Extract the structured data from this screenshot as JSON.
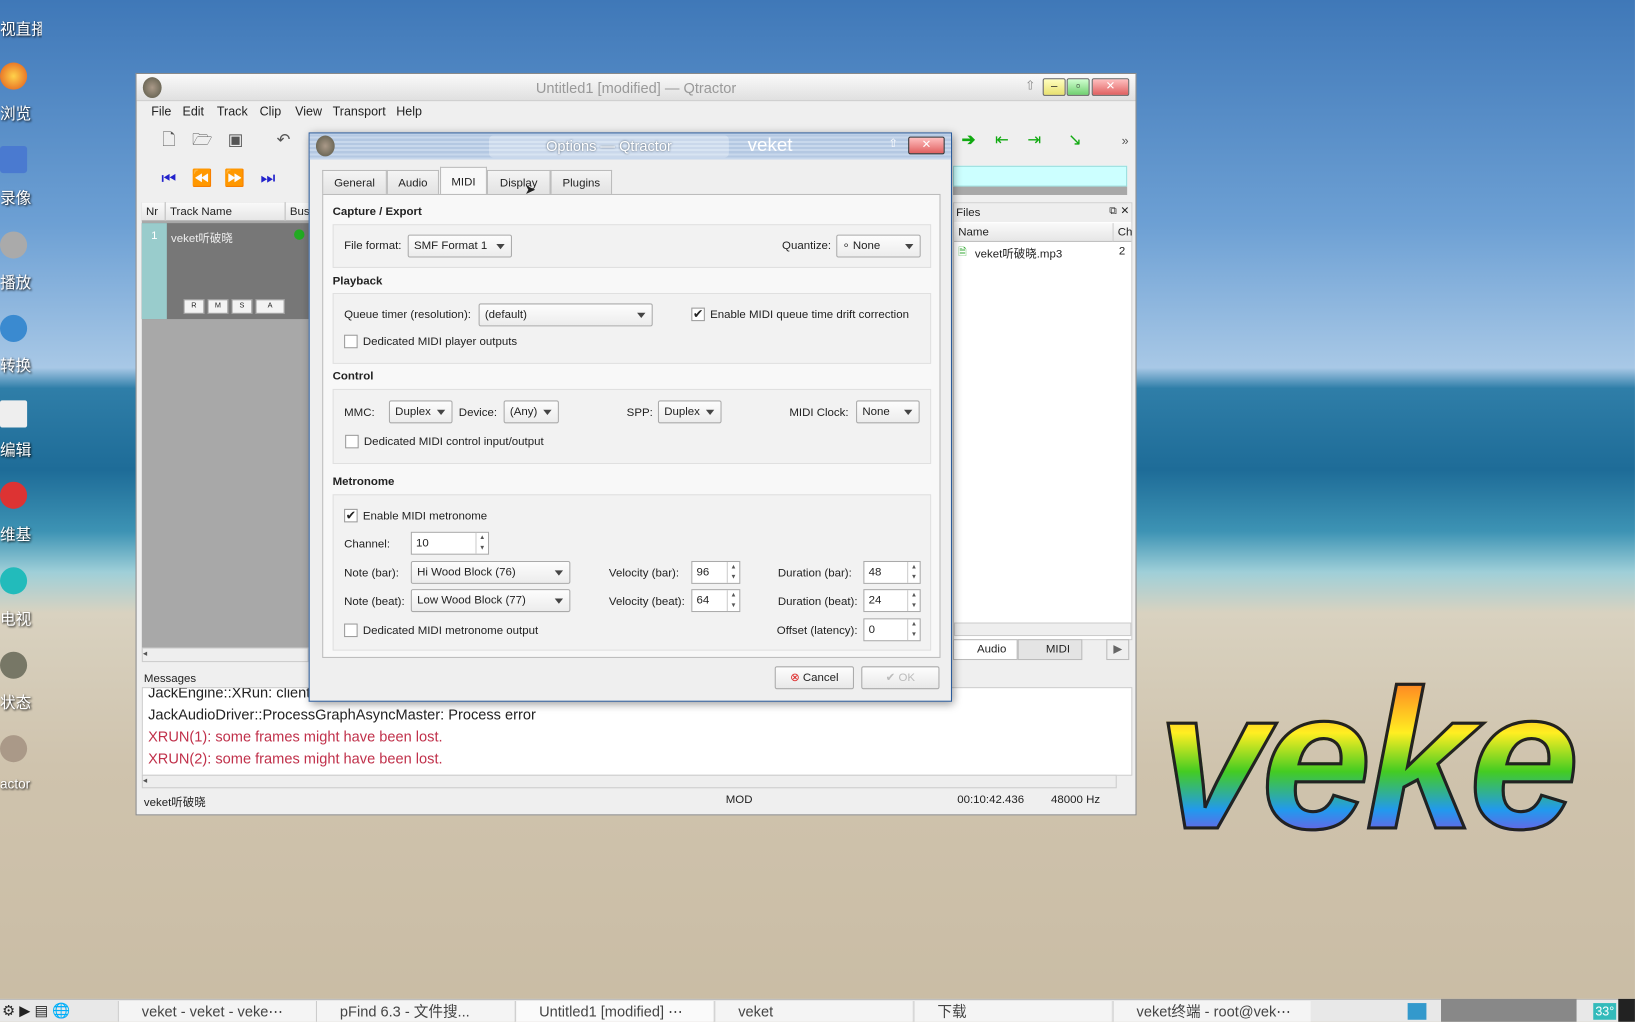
{
  "desktop": {
    "icons": [
      "视直播",
      "浏览",
      "录像",
      "播放",
      "转换",
      "编辑",
      "维基",
      "电视",
      "状态",
      "actor"
    ],
    "logo_text": "veke"
  },
  "main_window": {
    "title": "Untitled1 [modified] — Qtractor",
    "menu": [
      "File",
      "Edit",
      "Track",
      "Clip",
      "View",
      "Transport",
      "Help"
    ],
    "tracks_header": {
      "nr": "Nr",
      "name": "Track Name",
      "bus": "Bus"
    },
    "tracks": [
      {
        "nr": "1",
        "name": "veket听破晓",
        "buttons": [
          "R",
          "M",
          "S",
          "A"
        ]
      }
    ],
    "files": {
      "title": "Files",
      "col_name": "Name",
      "col_ch": "Ch",
      "items": [
        {
          "name": "veket听破晓.mp3",
          "ch": "2"
        }
      ],
      "tabs": [
        "Audio",
        "MIDI"
      ]
    },
    "messages": {
      "title": "Messages",
      "lines": [
        {
          "text": "JackEngine::XRun: client",
          "error": false
        },
        {
          "text": "JackAudioDriver::ProcessGraphAsyncMaster: Process error",
          "error": false
        },
        {
          "text": "XRUN(1): some frames might have been lost.",
          "error": true
        },
        {
          "text": "XRUN(2): some frames might have been lost.",
          "error": true
        }
      ]
    },
    "status": {
      "track": "veket听破晓",
      "mod": "MOD",
      "time": "00:10:42.436",
      "rate": "48000 Hz"
    }
  },
  "dialog": {
    "title": "Options — Qtractor",
    "title_extra": "veket",
    "tabs": [
      "General",
      "Audio",
      "MIDI",
      "Display",
      "Plugins"
    ],
    "active_tab": "MIDI",
    "capture": {
      "title": "Capture / Export",
      "file_format_label": "File format:",
      "file_format": "SMF Format 1",
      "quantize_label": "Quantize:",
      "quantize": "∘ None"
    },
    "playback": {
      "title": "Playback",
      "queue_timer_label": "Queue timer (resolution):",
      "queue_timer": "(default)",
      "drift_label": "Enable MIDI queue time drift correction",
      "drift_checked": true,
      "player_outputs_label": "Dedicated MIDI player outputs",
      "player_outputs_checked": false
    },
    "control": {
      "title": "Control",
      "mmc_label": "MMC:",
      "mmc": "Duplex",
      "device_label": "Device:",
      "device": "(Any)",
      "spp_label": "SPP:",
      "spp": "Duplex",
      "clock_label": "MIDI Clock:",
      "clock": "None",
      "dedicated_label": "Dedicated MIDI control input/output",
      "dedicated_checked": false
    },
    "metronome": {
      "title": "Metronome",
      "enable_label": "Enable MIDI metronome",
      "enable_checked": true,
      "channel_label": "Channel:",
      "channel": "10",
      "note_bar_label": "Note (bar):",
      "note_bar": "Hi Wood Block (76)",
      "note_beat_label": "Note (beat):",
      "note_beat": "Low Wood Block (77)",
      "vel_bar_label": "Velocity (bar):",
      "vel_bar": "96",
      "vel_beat_label": "Velocity (beat):",
      "vel_beat": "64",
      "dur_bar_label": "Duration (bar):",
      "dur_bar": "48",
      "dur_beat_label": "Duration (beat):",
      "dur_beat": "24",
      "offset_label": "Offset (latency):",
      "offset": "0",
      "output_label": "Dedicated MIDI metronome output",
      "output_checked": false
    },
    "cancel": "Cancel",
    "ok": "OK"
  },
  "taskbar": {
    "items": [
      "veket - veket - veke⋯",
      "pFind 6.3 - 文件搜...",
      "Untitled1 [modified] ⋯",
      "veket",
      "下载",
      "veket终端 - root@vek⋯"
    ],
    "temp": "33°"
  }
}
